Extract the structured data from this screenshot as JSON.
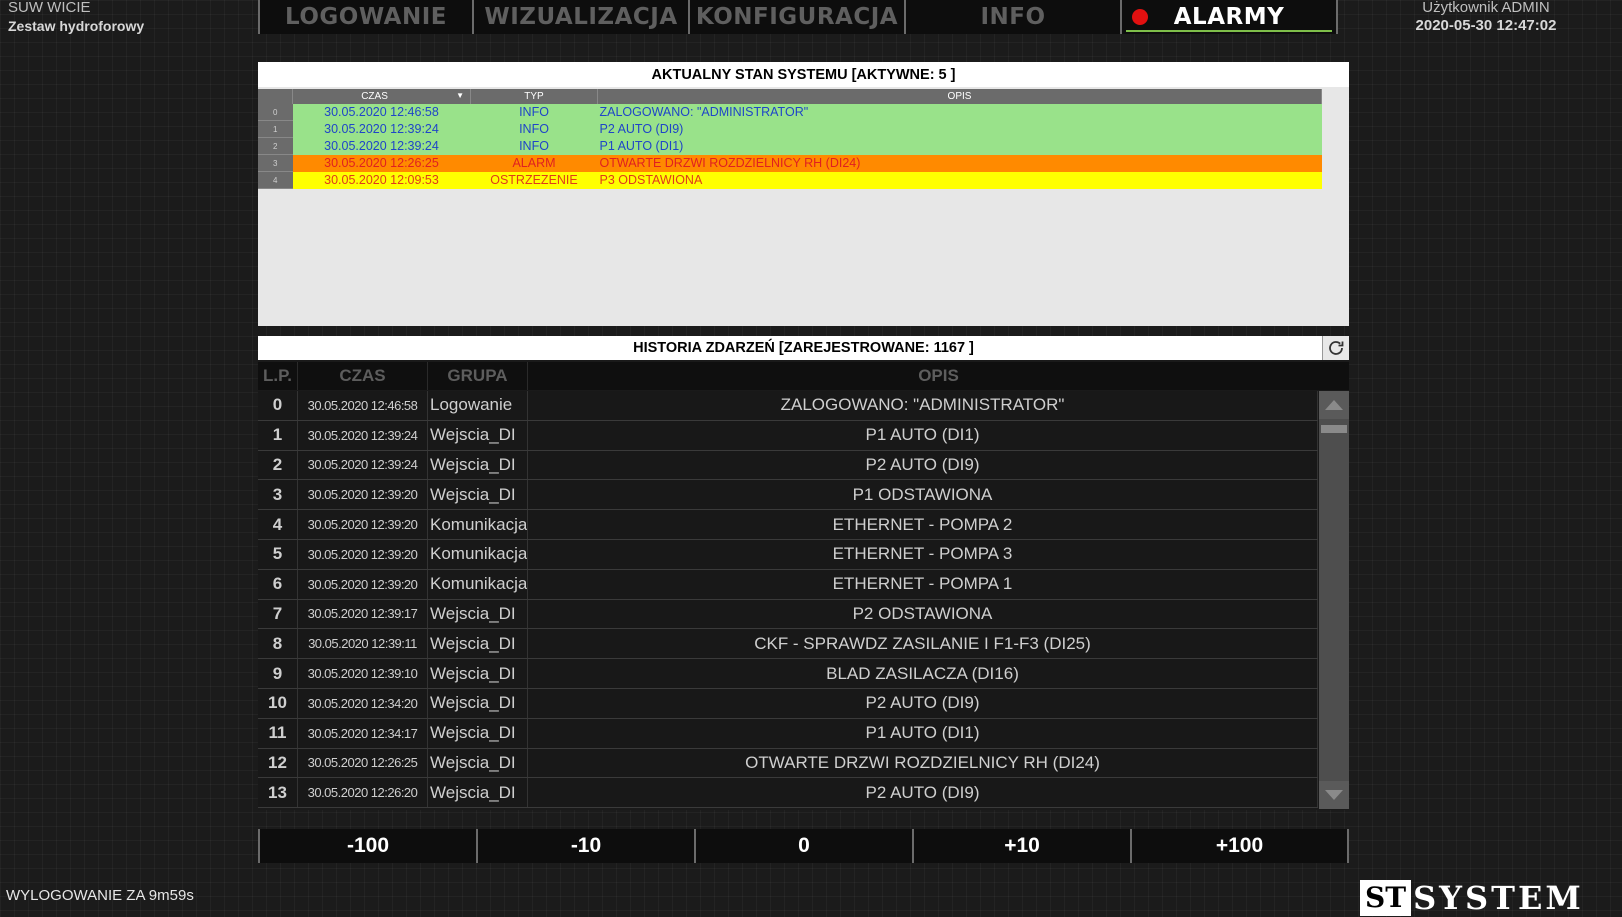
{
  "header": {
    "site_name": "SUW WICIE",
    "site_sub": "Zestaw hydroforowy",
    "user_label": "Użytkownik ADMIN",
    "clock": "2020-05-30 12:47:02"
  },
  "nav": {
    "tabs": [
      {
        "label": "LOGOWANIE"
      },
      {
        "label": "WIZUALIZACJA"
      },
      {
        "label": "KONFIGURACJA"
      },
      {
        "label": "INFO"
      },
      {
        "label": "ALARMY"
      }
    ],
    "active": "ALARMY",
    "alarm_indicator_color": "#e21010"
  },
  "active_panel": {
    "title": "AKTUALNY STAN SYSTEMU [AKTYWNE: 5 ]",
    "columns": [
      "CZAS",
      "TYP",
      "OPIS"
    ],
    "rows": [
      {
        "idx": "0",
        "time": "30.05.2020 12:46:58",
        "type": "INFO",
        "desc": "ZALOGOWANO: \"ADMINISTRATOR\"",
        "bg": "#99e28a",
        "fg": "#1f45c8"
      },
      {
        "idx": "1",
        "time": "30.05.2020 12:39:24",
        "type": "INFO",
        "desc": "P2 AUTO (DI9)",
        "bg": "#99e28a",
        "fg": "#1f45c8"
      },
      {
        "idx": "2",
        "time": "30.05.2020 12:39:24",
        "type": "INFO",
        "desc": "P1 AUTO (DI1)",
        "bg": "#99e28a",
        "fg": "#1f45c8"
      },
      {
        "idx": "3",
        "time": "30.05.2020 12:26:25",
        "type": "ALARM",
        "desc": "OTWARTE DRZWI ROZDZIELNICY RH (DI24)",
        "bg": "#ff8a00",
        "fg": "#e02020"
      },
      {
        "idx": "4",
        "time": "30.05.2020 12:09:53",
        "type": "OSTRZEZENIE",
        "desc": "P3 ODSTAWIONA",
        "bg": "#ffff00",
        "fg": "#e03a1a"
      }
    ]
  },
  "history_panel": {
    "title": "HISTORIA ZDARZEŃ [ZAREJESTROWANE: 1167 ]",
    "columns": [
      "L.P.",
      "CZAS",
      "GRUPA",
      "OPIS"
    ],
    "rows": [
      {
        "lp": "0",
        "time": "30.05.2020 12:46:58",
        "group": "Logowanie",
        "desc": "ZALOGOWANO: \"ADMINISTRATOR\""
      },
      {
        "lp": "1",
        "time": "30.05.2020 12:39:24",
        "group": "Wejscia_DI",
        "desc": "P1 AUTO (DI1)"
      },
      {
        "lp": "2",
        "time": "30.05.2020 12:39:24",
        "group": "Wejscia_DI",
        "desc": "P2 AUTO (DI9)"
      },
      {
        "lp": "3",
        "time": "30.05.2020 12:39:20",
        "group": "Wejscia_DI",
        "desc": "P1 ODSTAWIONA"
      },
      {
        "lp": "4",
        "time": "30.05.2020 12:39:20",
        "group": "Komunikacja",
        "desc": "ETHERNET - POMPA 2"
      },
      {
        "lp": "5",
        "time": "30.05.2020 12:39:20",
        "group": "Komunikacja",
        "desc": "ETHERNET - POMPA 3"
      },
      {
        "lp": "6",
        "time": "30.05.2020 12:39:20",
        "group": "Komunikacja",
        "desc": "ETHERNET - POMPA 1"
      },
      {
        "lp": "7",
        "time": "30.05.2020 12:39:17",
        "group": "Wejscia_DI",
        "desc": "P2 ODSTAWIONA"
      },
      {
        "lp": "8",
        "time": "30.05.2020 12:39:11",
        "group": "Wejscia_DI",
        "desc": "CKF - SPRAWDZ ZASILANIE I F1-F3 (DI25)"
      },
      {
        "lp": "9",
        "time": "30.05.2020 12:39:10",
        "group": "Wejscia_DI",
        "desc": "BLAD ZASILACZA (DI16)"
      },
      {
        "lp": "10",
        "time": "30.05.2020 12:34:20",
        "group": "Wejscia_DI",
        "desc": "P2 AUTO (DI9)"
      },
      {
        "lp": "11",
        "time": "30.05.2020 12:34:17",
        "group": "Wejscia_DI",
        "desc": "P1 AUTO (DI1)"
      },
      {
        "lp": "12",
        "time": "30.05.2020 12:26:25",
        "group": "Wejscia_DI",
        "desc": "OTWARTE DRZWI ROZDZIELNICY RH (DI24)"
      },
      {
        "lp": "13",
        "time": "30.05.2020 12:26:20",
        "group": "Wejscia_DI",
        "desc": "P2 AUTO (DI9)"
      }
    ]
  },
  "pager": {
    "buttons": [
      "-100",
      "-10",
      "0",
      "+10",
      "+100"
    ]
  },
  "footer": {
    "logout_timer": "WYLOGOWANIE ZA 9m59s",
    "logo_st": "ST",
    "logo_system": "SYSTEM"
  },
  "icons": {
    "refresh": "refresh-icon",
    "scroll_up": "arrow-up-icon",
    "scroll_down": "arrow-down-icon",
    "sort": "sort-down-icon"
  }
}
